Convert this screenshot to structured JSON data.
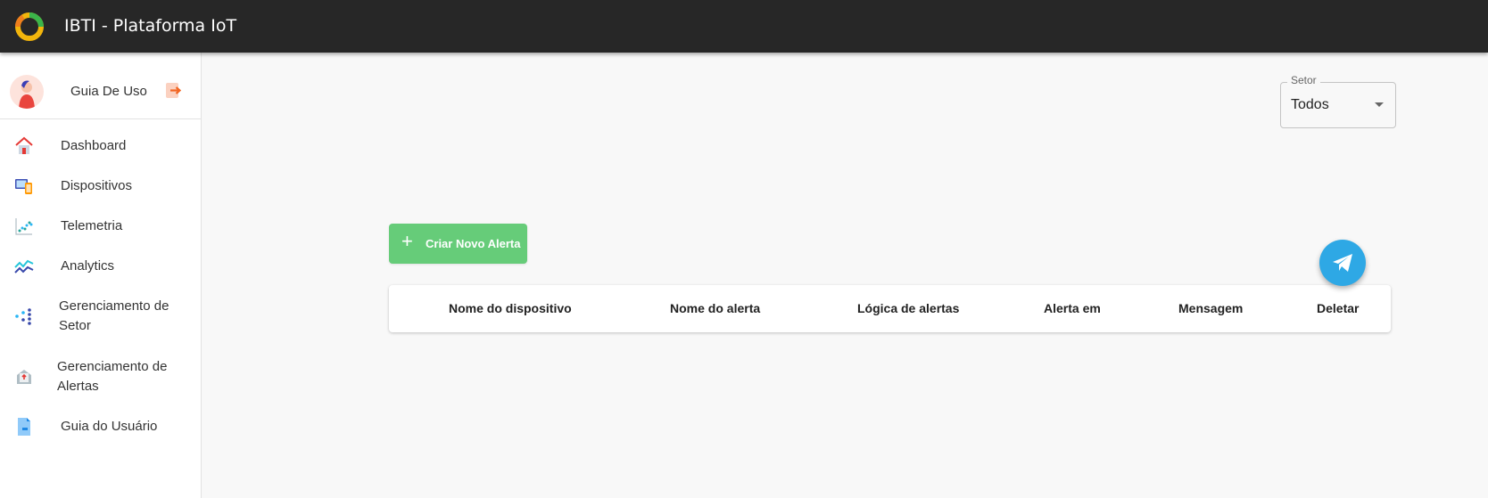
{
  "header": {
    "title": "IBTI - Plataforma IoT",
    "logo_icon": "circular-logo-icon"
  },
  "sidebar": {
    "user": {
      "name": "Guia De Uso",
      "avatar_icon": "user-avatar-icon",
      "logout_icon": "logout-icon"
    },
    "items": [
      {
        "label": "Dashboard",
        "icon": "home-icon"
      },
      {
        "label": "Dispositivos",
        "icon": "devices-icon"
      },
      {
        "label": "Telemetria",
        "icon": "telemetry-icon"
      },
      {
        "label": "Analytics",
        "icon": "analytics-icon"
      },
      {
        "label_line1": "Gerenciamento de",
        "label_line2": "Setor",
        "icon": "sector-icon"
      },
      {
        "label_line1": "Gerenciamento de",
        "label_line2": "Alertas",
        "icon": "alerts-icon"
      },
      {
        "label": "Guia do Usuário",
        "icon": "guide-document-icon"
      }
    ]
  },
  "filter": {
    "label": "Setor",
    "value": "Todos"
  },
  "actions": {
    "create_alert_label": "Criar Novo Alerta"
  },
  "table": {
    "columns": [
      "Nome do dispositivo",
      "Nome do alerta",
      "Lógica de alertas",
      "Alerta em",
      "Mensagem",
      "Deletar"
    ],
    "rows": []
  },
  "fab": {
    "icon": "telegram-icon"
  },
  "colors": {
    "topbar": "#272727",
    "create_button": "#66cc79",
    "fab": "#2ea8e5"
  }
}
